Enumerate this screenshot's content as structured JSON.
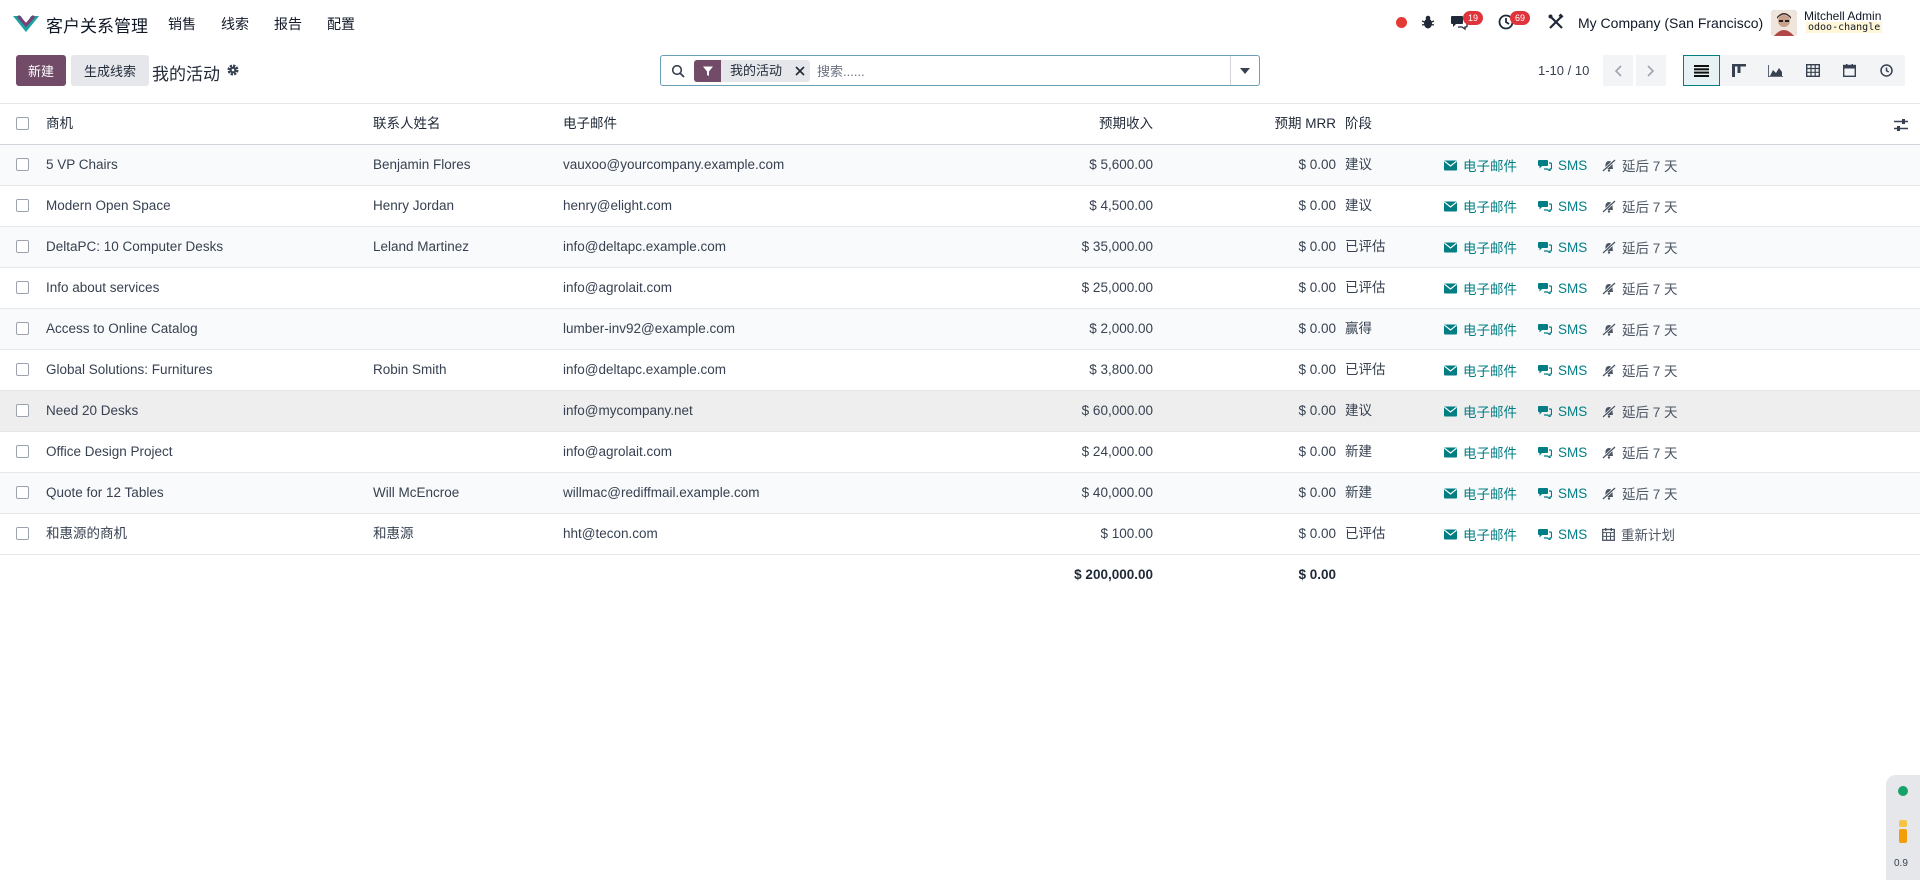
{
  "navbar": {
    "app_name": "客户关系管理",
    "menus": [
      "销售",
      "线索",
      "报告",
      "配置"
    ],
    "messages_count": "19",
    "activities_count": "69",
    "company": "My Company (San Francisco)",
    "user_name": "Mitchell Admin",
    "db_name": "odoo-changle"
  },
  "control": {
    "new_label": "新建",
    "generate_label": "生成线索",
    "view_title": "我的活动",
    "facet_label": "我的活动",
    "search_placeholder": "搜索......",
    "pager": "1-10 / 10"
  },
  "table": {
    "columns": {
      "name": "商机",
      "contact": "联系人姓名",
      "email": "电子邮件",
      "revenue": "预期收入",
      "mrr": "预期 MRR",
      "stage": "阶段"
    },
    "action_labels": {
      "email": "电子邮件",
      "sms": "SMS",
      "snooze": "延后 7 天",
      "reschedule": "重新计划"
    },
    "rows": [
      {
        "name": "5 VP Chairs",
        "contact": "Benjamin Flores",
        "email": "vauxoo@yourcompany.example.com",
        "revenue": "$ 5,600.00",
        "mrr": "$ 0.00",
        "stage": "建议",
        "third_action": "snooze"
      },
      {
        "name": "Modern Open Space",
        "contact": "Henry Jordan",
        "email": "henry@elight.com",
        "revenue": "$ 4,500.00",
        "mrr": "$ 0.00",
        "stage": "建议",
        "third_action": "snooze"
      },
      {
        "name": "DeltaPC: 10 Computer Desks",
        "contact": "Leland Martinez",
        "email": "info@deltapc.example.com",
        "revenue": "$ 35,000.00",
        "mrr": "$ 0.00",
        "stage": "已评估",
        "third_action": "snooze"
      },
      {
        "name": "Info about services",
        "contact": "",
        "email": "info@agrolait.com",
        "revenue": "$ 25,000.00",
        "mrr": "$ 0.00",
        "stage": "已评估",
        "third_action": "snooze"
      },
      {
        "name": "Access to Online Catalog",
        "contact": "",
        "email": "lumber-inv92@example.com",
        "revenue": "$ 2,000.00",
        "mrr": "$ 0.00",
        "stage": "赢得",
        "third_action": "snooze"
      },
      {
        "name": "Global Solutions: Furnitures",
        "contact": "Robin Smith",
        "email": "info@deltapc.example.com",
        "revenue": "$ 3,800.00",
        "mrr": "$ 0.00",
        "stage": "已评估",
        "third_action": "snooze"
      },
      {
        "name": "Need 20 Desks",
        "contact": "",
        "email": "info@mycompany.net",
        "revenue": "$ 60,000.00",
        "mrr": "$ 0.00",
        "stage": "建议",
        "third_action": "snooze"
      },
      {
        "name": "Office Design Project",
        "contact": "",
        "email": "info@agrolait.com",
        "revenue": "$ 24,000.00",
        "mrr": "$ 0.00",
        "stage": "新建",
        "third_action": "snooze"
      },
      {
        "name": "Quote for 12 Tables",
        "contact": "Will McEncroe",
        "email": "willmac@rediffmail.example.com",
        "revenue": "$ 40,000.00",
        "mrr": "$ 0.00",
        "stage": "新建",
        "third_action": "snooze"
      },
      {
        "name": "和惠源的商机",
        "contact": "和惠源",
        "email": "hht@tecon.com",
        "revenue": "$ 100.00",
        "mrr": "$ 0.00",
        "stage": "已评估",
        "third_action": "reschedule"
      }
    ],
    "totals": {
      "revenue": "$ 200,000.00",
      "mrr": "$ 0.00"
    }
  },
  "widget": {
    "value": "0.9"
  },
  "colors": {
    "brand": "#714b67",
    "accent": "#017e84",
    "badge": "#e0343c"
  }
}
